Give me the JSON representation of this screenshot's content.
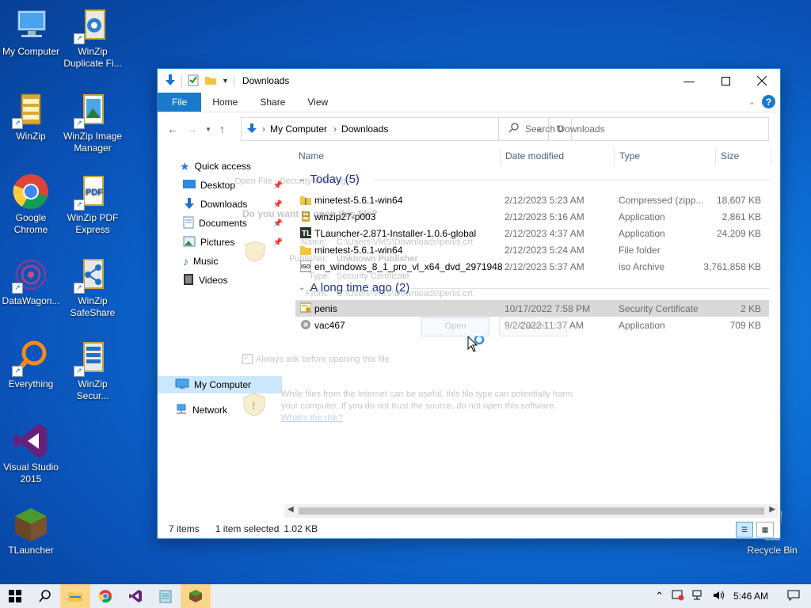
{
  "desktop": {
    "icons": [
      {
        "label": "My Computer",
        "icon": "computer-icon"
      },
      {
        "label": "WinZip Duplicate Fi...",
        "icon": "winzip-duplicate-icon"
      },
      {
        "label": "WinZip",
        "icon": "winzip-icon"
      },
      {
        "label": "WinZip Image Manager",
        "icon": "winzip-image-icon"
      },
      {
        "label": "Google Chrome",
        "icon": "chrome-icon"
      },
      {
        "label": "WinZip PDF Express",
        "icon": "pdf-icon"
      },
      {
        "label": "DataWagon...",
        "icon": "datawagon-icon"
      },
      {
        "label": "WinZip SafeShare",
        "icon": "safeshare-icon"
      },
      {
        "label": "Everything",
        "icon": "search-icon"
      },
      {
        "label": "WinZip Secur...",
        "icon": "winzip-secure-icon"
      },
      {
        "label": "Visual Studio 2015",
        "icon": "visual-studio-icon"
      },
      {
        "label": "TLauncher",
        "icon": "tlauncher-icon"
      },
      {
        "label": "Recycle Bin",
        "icon": "recycle-bin-icon"
      }
    ]
  },
  "window": {
    "title": "Downloads",
    "ribbon": {
      "file": "File",
      "home": "Home",
      "share": "Share",
      "view": "View",
      "help": "?"
    },
    "address": {
      "root": "My Computer",
      "current": "Downloads"
    },
    "search": {
      "placeholder": "Search Downloads"
    },
    "nav": {
      "quick_access": "Quick access",
      "desktop": "Desktop",
      "downloads": "Downloads",
      "documents": "Documents",
      "pictures": "Pictures",
      "music": "Music",
      "videos": "Videos",
      "my_computer": "My Computer",
      "network": "Network"
    },
    "columns": {
      "name": "Name",
      "date": "Date modified",
      "type": "Type",
      "size": "Size"
    },
    "groups": {
      "today": "Today (5)",
      "long_ago": "A long time ago (2)"
    },
    "files_today": [
      {
        "name": "minetest-5.6.1-win64",
        "date": "2/12/2023 5:23 AM",
        "type": "Compressed (zipp...",
        "size": "18,607 KB",
        "icon": "zip-folder-icon"
      },
      {
        "name": "winzip27-p003",
        "date": "2/12/2023 5:16 AM",
        "type": "Application",
        "size": "2,861 KB",
        "icon": "winzip-app-icon"
      },
      {
        "name": "TLauncher-2.871-Installer-1.0.6-global",
        "date": "2/12/2023 4:37 AM",
        "type": "Application",
        "size": "24,209 KB",
        "icon": "tlauncher-app-icon"
      },
      {
        "name": "minetest-5.6.1-win64",
        "date": "2/12/2023 5:24 AM",
        "type": "File folder",
        "size": "",
        "icon": "folder-icon"
      },
      {
        "name": "en_windows_8_1_pro_vl_x64_dvd_2971948",
        "date": "2/12/2023 5:37 AM",
        "type": "iso Archive",
        "size": "3,761,858 KB",
        "icon": "iso-icon"
      }
    ],
    "files_old": [
      {
        "name": "penis",
        "date": "10/17/2022 7:58 PM",
        "type": "Security Certificate",
        "size": "2 KB",
        "icon": "certificate-icon"
      },
      {
        "name": "vac467",
        "date": "9/2/2022 11:37 AM",
        "type": "Application",
        "size": "709 KB",
        "icon": "app-icon"
      }
    ],
    "status": {
      "items": "7 items",
      "selected": "1 item selected",
      "size": "1.02 KB"
    }
  },
  "ghost_dialog": {
    "title": "Open File - Security Warning",
    "question": "Do you want to open this file?",
    "name_label": "Name:",
    "name_value": "C:\\Users\\VMS\\Downloads\\penis.crt",
    "publisher_label": "Publisher:",
    "publisher_value": "Unknown Publisher",
    "type_label": "Type:",
    "type_value": "Security Certificate",
    "from_label": "From:",
    "from_value": "C:\\Users\\VMS\\Downloads\\penis.crt",
    "open": "Open",
    "cancel": "Cancel",
    "checkbox": "Always ask before opening this file",
    "warning": "While files from the Internet can be useful, this file type can potentially harm your computer. If you do not trust the source, do not open this software.",
    "risk_link": "What's the risk?"
  },
  "taskbar": {
    "items": [
      "start-icon",
      "search-icon",
      "file-explorer-icon",
      "chrome-icon",
      "visual-studio-icon",
      "notepad-icon",
      "minecraft-icon"
    ],
    "time": "5:46 AM"
  }
}
